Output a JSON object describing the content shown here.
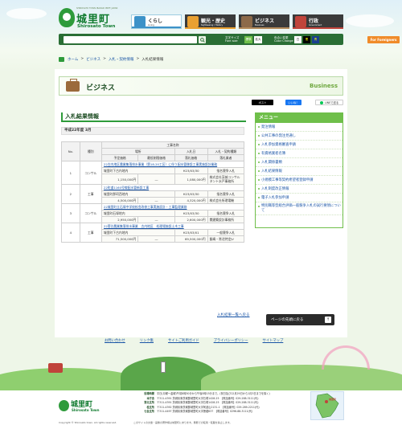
{
  "header": {
    "logo_small": "SHIROSATO TOWN  IBARAKI PREF. JAPAN",
    "logo_title": "城里町",
    "logo_en": "Shirosato Town"
  },
  "gnav": [
    {
      "label": "くらし",
      "sub": "Living"
    },
    {
      "label": "観光・歴史",
      "sub": "Sightseeing / History"
    },
    {
      "label": "ビジネス",
      "sub": "Business"
    },
    {
      "label": "行政",
      "sub": "Government"
    }
  ],
  "search": {
    "placeholder": "",
    "button_icon": "search-icon"
  },
  "controls": {
    "font_label": "文字サイズ",
    "font_sub": "Font size",
    "std": "標準",
    "large": "拡大",
    "color_label": "色合い変更",
    "color_sub": "Color Change",
    "c1": "白",
    "c2": "黒",
    "c3": "青",
    "foreign": "For Foreigners"
  },
  "breadcrumb": [
    "ホーム",
    "ビジネス",
    "入札・契約情報",
    "入札結果情報"
  ],
  "section": {
    "title": "ビジネス",
    "en": "Business"
  },
  "social": {
    "post": "ポスト",
    "like": "いいね！",
    "line": "LINEで送る"
  },
  "page": {
    "title": "入札結果情報",
    "subhead": "平成22年度 3月",
    "back_link": "入札結果一覧へ戻る",
    "pagetop": "ページの先頭に戻る",
    "pagetop_arrow": "↑"
  },
  "table": {
    "headers": {
      "no": "No.",
      "type": "種別",
      "work": "工事名称",
      "place": "場所",
      "date": "入札日",
      "method": "入札・契約種類",
      "planned": "予定価格",
      "min": "最低制限価格",
      "winprice": "落札価格",
      "winner": "落札業者"
    },
    "rows": [
      {
        "no": "1",
        "type": "コンサル",
        "name": "22古内地区農業集落排水事業（第18-20工区）に伴う配水管移設工事実施設計業務",
        "place": "城里町下古内地内",
        "date": "H23/03/30",
        "method": "指名競争入札",
        "planned": "1,150,000円",
        "min": "―",
        "winprice": "1,080,000円",
        "winner": "株式会社茨城コンサルタント水戸事務所"
      },
      {
        "no": "2",
        "type": "工事",
        "name": "22町道1160号線配水管新設工事",
        "place": "城里町那珂西地内",
        "date": "H23/03/30",
        "method": "指名競争入札",
        "planned": "4,500,000円",
        "min": "―",
        "winprice": "4,320,000円",
        "winner": "株式会社所理電機"
      },
      {
        "no": "3",
        "type": "コンサル",
        "name": "22城里町立石塚中学校校舎改修工事実施設計・工事監理業務",
        "place": "城里町石塚地内",
        "date": "H23/03/30",
        "method": "指名競争入札",
        "planned": "2,950,000円",
        "min": "―",
        "winprice": "2,600,000円",
        "winner": "関建築設計事務所"
      },
      {
        "no": "4",
        "type": "工事",
        "name": "22菅谷農業集落排水事業　古内地区　処理場施設土木工事",
        "place": "城里町下古内地内",
        "date": "H23/03/01",
        "method": "一般競争入札",
        "planned": "71,500,000円",
        "min": "―",
        "winprice": "69,500,000円",
        "winner": "飯嶋・常北特定JV"
      }
    ]
  },
  "menu": {
    "title": "メニュー",
    "items": [
      "発注情報",
      "公共工事の発注見通し",
      "入札参加資格審査申請",
      "有資格業者名簿",
      "入札関係書類",
      "入札結果情報",
      "小規模工事等契約希望者登録申請",
      "入札制度改正情報",
      "電子入札参加申請",
      "特別職等型総合評価一般競争入札の試行要領について"
    ]
  },
  "footlinks": [
    "お問い合わせ",
    "リンク集",
    "サイトご利用ガイド",
    "プライバシーポリシー",
    "サイトマップ"
  ],
  "footer": {
    "logo_title": "城里町",
    "logo_en": "Shirosato Town",
    "lines": [
      {
        "k": "役場時間",
        "v": "平日(月曜〜金曜)午前8時30分から午後5時15分まで。(祝日及び12月29日から1月3日までを除く)"
      },
      {
        "k": "本庁舎",
        "v": "〒311-4391 茨城県東茨城郡城里町大字石塚1428-25　【電話番号】029-288-3111(代)"
      },
      {
        "k": "常北支所",
        "v": "〒311-4391 茨城県東茨城郡城里町大字石塚1428-25　【電話番号】029-288-3111(代)"
      },
      {
        "k": "桂支所",
        "v": "〒311-4392 茨城県東茨城郡城里町大字阿波山2131-1　【電話番号】029-289-2211(代)"
      },
      {
        "k": "七会支所",
        "v": "〒311-4497 茨城県東茨城郡城里町大字徳蔵637　【電話番号】0296-88-3111(代)"
      }
    ],
    "map_label": "城里町",
    "copyright": "Copyright © Shirosato town. All rights reserved.",
    "note": "このサイトの文章・画像の著作権は城里町にあります。無断での転用・転載を禁止します。"
  }
}
